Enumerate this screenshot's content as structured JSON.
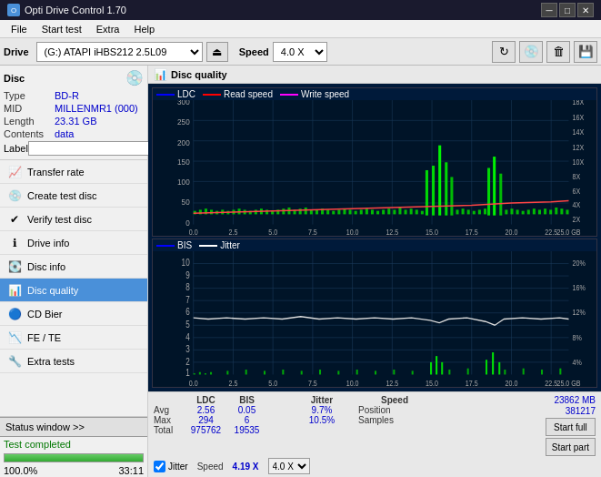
{
  "app": {
    "title": "Opti Drive Control 1.70",
    "title_icon": "O"
  },
  "title_buttons": {
    "minimize": "─",
    "maximize": "□",
    "close": "✕"
  },
  "menu": {
    "items": [
      "File",
      "Start test",
      "Extra",
      "Help"
    ]
  },
  "drive_toolbar": {
    "label": "Drive",
    "drive_value": "(G:) ATAPI iHBS212  2.5L09",
    "speed_label": "Speed",
    "speed_value": "4.0 X",
    "eject_icon": "⏏"
  },
  "disc": {
    "title": "Disc",
    "type_label": "Type",
    "type_value": "BD-R",
    "mid_label": "MID",
    "mid_value": "MILLENMR1 (000)",
    "length_label": "Length",
    "length_value": "23.31 GB",
    "contents_label": "Contents",
    "contents_value": "data",
    "label_label": "Label",
    "label_value": ""
  },
  "nav": {
    "items": [
      {
        "id": "transfer-rate",
        "label": "Transfer rate",
        "icon": "📈"
      },
      {
        "id": "create-test-disc",
        "label": "Create test disc",
        "icon": "💿"
      },
      {
        "id": "verify-test-disc",
        "label": "Verify test disc",
        "icon": "✅"
      },
      {
        "id": "drive-info",
        "label": "Drive info",
        "icon": "ℹ"
      },
      {
        "id": "disc-info",
        "label": "Disc info",
        "icon": "💽"
      },
      {
        "id": "disc-quality",
        "label": "Disc quality",
        "icon": "📊",
        "active": true
      },
      {
        "id": "cd-bier",
        "label": "CD Bier",
        "icon": "🔵"
      },
      {
        "id": "fe-te",
        "label": "FE / TE",
        "icon": "📉"
      },
      {
        "id": "extra-tests",
        "label": "Extra tests",
        "icon": "🔧"
      }
    ]
  },
  "status": {
    "status_window_btn": "Status window >>",
    "status_text": "Test completed",
    "progress_percent": 100,
    "progress_text": "100.0%",
    "time_text": "33:11"
  },
  "panel": {
    "title": "Disc quality",
    "icon": "📊"
  },
  "chart_top": {
    "legend": [
      {
        "label": "LDC",
        "color": "#0000ff"
      },
      {
        "label": "Read speed",
        "color": "#ff0000"
      },
      {
        "label": "Write speed",
        "color": "#ff00ff"
      }
    ],
    "y_max": 300,
    "y_labels_left": [
      "300",
      "250",
      "200",
      "150",
      "100",
      "50",
      "0"
    ],
    "y_labels_right": [
      "18X",
      "16X",
      "14X",
      "12X",
      "10X",
      "8X",
      "6X",
      "4X",
      "2X"
    ],
    "x_labels": [
      "0.0",
      "2.5",
      "5.0",
      "7.5",
      "10.0",
      "12.5",
      "15.0",
      "17.5",
      "20.0",
      "22.5",
      "25.0 GB"
    ]
  },
  "chart_bottom": {
    "legend": [
      {
        "label": "BIS",
        "color": "#0000ff"
      },
      {
        "label": "Jitter",
        "color": "#ffffff"
      }
    ],
    "y_max": 10,
    "y_labels_left": [
      "10",
      "9",
      "8",
      "7",
      "6",
      "5",
      "4",
      "3",
      "2",
      "1"
    ],
    "y_labels_right": [
      "20%",
      "16%",
      "12%",
      "8%",
      "4%"
    ],
    "x_labels": [
      "0.0",
      "2.5",
      "5.0",
      "7.5",
      "10.0",
      "12.5",
      "15.0",
      "17.5",
      "20.0",
      "22.5",
      "25.0 GB"
    ]
  },
  "stats": {
    "columns": [
      "",
      "LDC",
      "BIS",
      "",
      "Jitter",
      "Speed",
      ""
    ],
    "rows": [
      {
        "label": "Avg",
        "ldc": "2.56",
        "bis": "0.05",
        "jitter": "9.7%",
        "speed_label": "Position",
        "speed_value": "23862 MB"
      },
      {
        "label": "Max",
        "ldc": "294",
        "bis": "6",
        "jitter": "10.5%",
        "speed_label": "Samples",
        "speed_value": "381217"
      },
      {
        "label": "Total",
        "ldc": "975762",
        "bis": "19535",
        "jitter": "",
        "speed_label": "",
        "speed_value": ""
      }
    ],
    "jitter_checked": true,
    "jitter_label": "Jitter",
    "speed_label": "Speed",
    "speed_value": "4.19 X",
    "speed_select": "4.0 X",
    "start_full_label": "Start full",
    "start_part_label": "Start part"
  }
}
